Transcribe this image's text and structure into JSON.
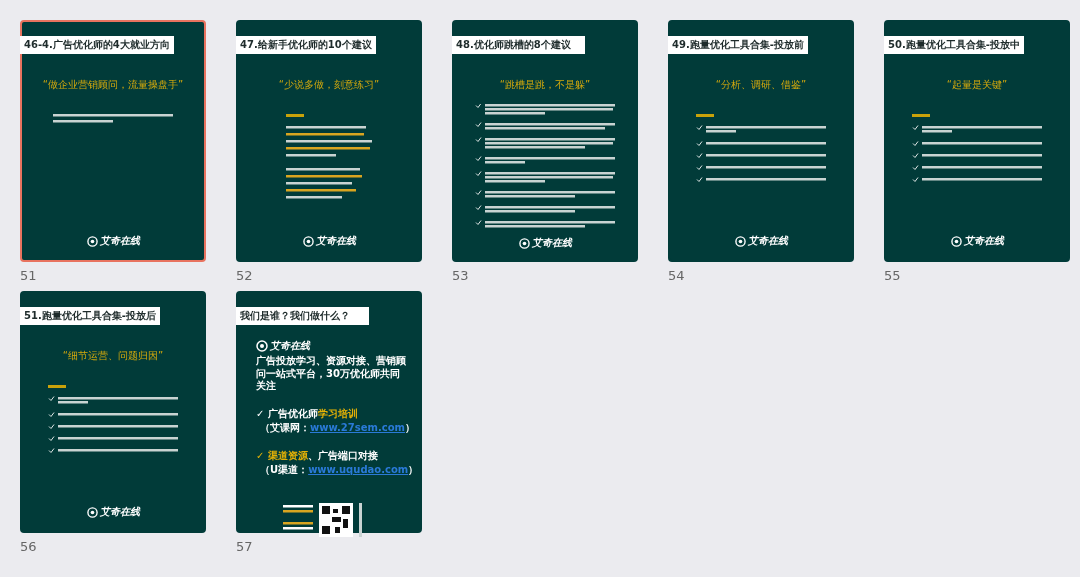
{
  "slides": [
    {
      "number": "51",
      "selected": true,
      "kind": "intro-paragraph",
      "title": "46-4.广告优化师的4大就业方向",
      "quote": "“做企业营销顾问，流量操盘手”",
      "logo": "艾奇在线"
    },
    {
      "number": "52",
      "selected": false,
      "kind": "numbered-list",
      "title": "47.给新手优化师的10个建议",
      "quote": "“少说多做，刻意练习”",
      "logo": "艾奇在线"
    },
    {
      "number": "53",
      "selected": false,
      "kind": "long-checklist",
      "title": "48.优化师跳槽的8个建议",
      "quote": "“跳槽是跳，不是躲”",
      "logo": "艾奇在线"
    },
    {
      "number": "54",
      "selected": false,
      "kind": "checklist",
      "title": "49.跑量优化工具合集-投放前",
      "quote": "“分析、调研、借鉴”",
      "logo": "艾奇在线"
    },
    {
      "number": "55",
      "selected": false,
      "kind": "checklist",
      "title": "50.跑量优化工具合集-投放中",
      "quote": "“起量是关键”",
      "logo": "艾奇在线"
    },
    {
      "number": "56",
      "selected": false,
      "kind": "checklist",
      "title": "51.跑量优化工具合集-投放后",
      "quote": "“细节运营、问题归因”",
      "logo": "艾奇在线"
    },
    {
      "number": "57",
      "selected": false,
      "kind": "about",
      "title": "我们是谁？我们做什么？",
      "logo": "艾奇在线",
      "intro": "广告投放学习、资源对接、营销顾问一站式平台，30万优化师共同关注",
      "offers": [
        {
          "check": "✓",
          "check_highlight": false,
          "parts": [
            {
              "text": "广告优化师",
              "highlight": false
            },
            {
              "text": "学习培训",
              "highlight": true
            }
          ],
          "site_label": "（艾课网：",
          "link": "www.27sem.com",
          "site_end": "）"
        },
        {
          "check": "✓",
          "check_highlight": true,
          "parts": [
            {
              "text": "渠道资源",
              "highlight": true
            },
            {
              "text": "、广告端口对接",
              "highlight": false
            }
          ],
          "site_label": "（U渠道：",
          "link": "www.uqudao.com",
          "site_end": "）"
        }
      ]
    }
  ]
}
